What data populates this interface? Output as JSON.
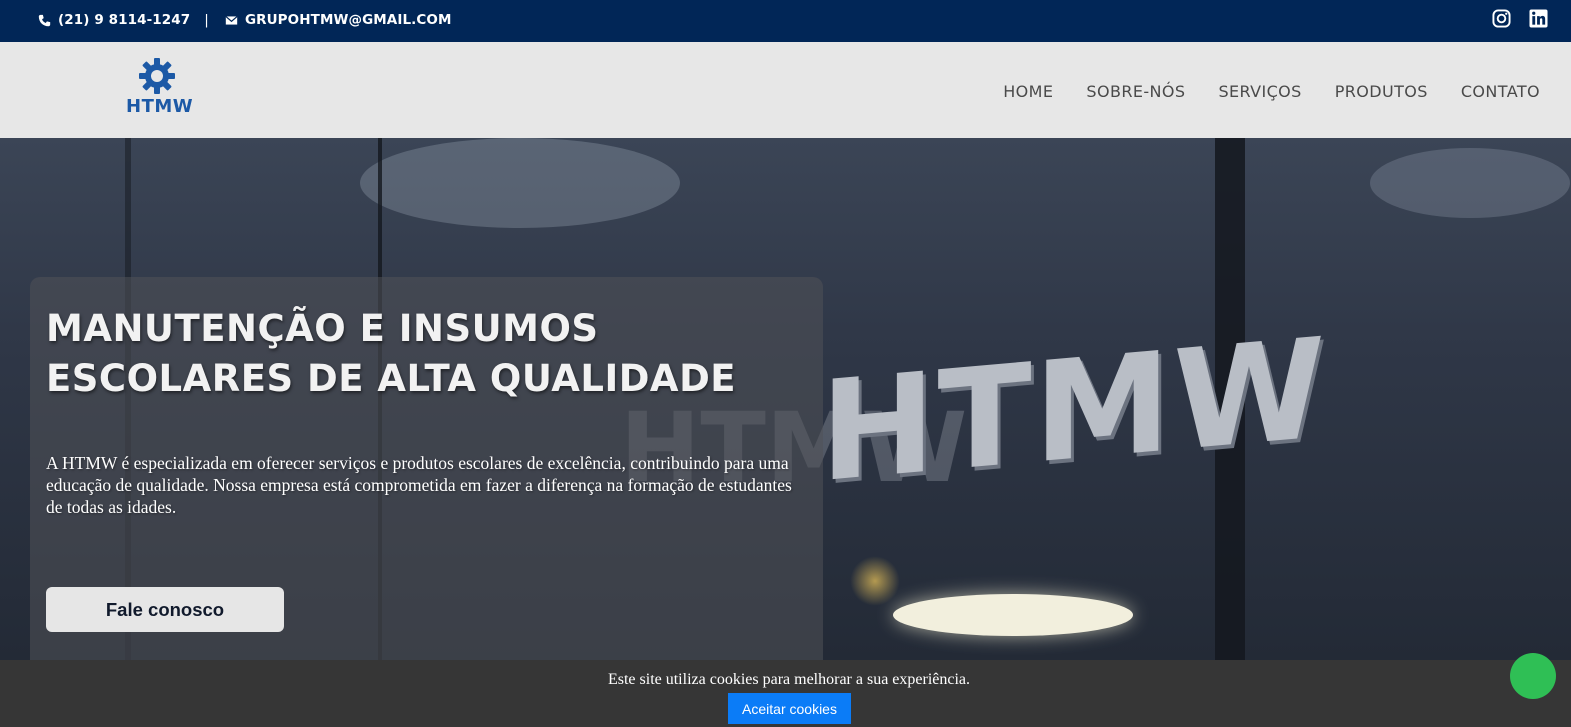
{
  "topbar": {
    "phone": "(21) 9 8114-1247",
    "separator": "|",
    "email": "GRUPOHTMW@GMAIL.COM",
    "phone_icon": "phone-icon",
    "email_icon": "envelope-icon",
    "social": [
      "instagram-icon",
      "linkedin-icon"
    ],
    "background": "#012657"
  },
  "header": {
    "logo_text": "HTMW",
    "logo_icon": "gear-icon",
    "nav": [
      {
        "label": "HOME"
      },
      {
        "label": "SOBRE-NÓS"
      },
      {
        "label": "SERVIÇOS"
      },
      {
        "label": "PRODUTOS"
      },
      {
        "label": "CONTATO"
      }
    ]
  },
  "hero": {
    "title": "MANUTENÇÃO E INSUMOS ESCOLARES DE ALTA QUALIDADE",
    "description": "A HTMW é especializada em oferecer serviços e produtos escolares de excelência, contribuindo para uma educação de qualidade. Nossa empresa está comprometida em fazer a diferença na formação de estudantes de todas as idades.",
    "cta_label": "Fale conosco",
    "sign_text": "HTMW"
  },
  "cookie": {
    "message": "Este site utiliza cookies para melhorar a sua experiência.",
    "accept_label": "Aceitar cookies",
    "accent": "#0b7cf7"
  },
  "whatsapp": {
    "icon": "whatsapp-icon",
    "color": "#2fbf55"
  }
}
